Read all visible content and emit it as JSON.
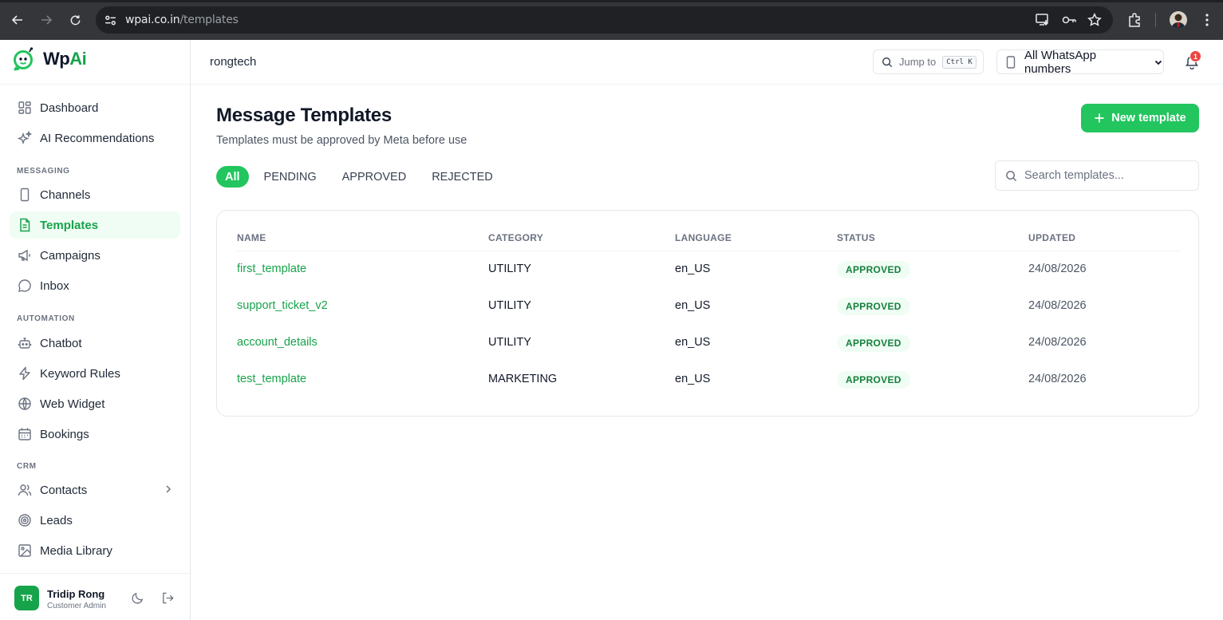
{
  "browser": {
    "url_host": "wpai.co.in",
    "url_path": "/templates"
  },
  "brand": {
    "name_part1": "Wp",
    "name_part2": "Ai",
    "accent": "#22c55e"
  },
  "sidebar": {
    "items_top": [
      {
        "label": "Dashboard",
        "icon": "grid-icon"
      },
      {
        "label": "AI Recommendations",
        "icon": "sparkles-icon"
      }
    ],
    "messaging_label": "MESSAGING",
    "messaging_items": [
      {
        "label": "Channels",
        "icon": "phone-icon"
      },
      {
        "label": "Templates",
        "icon": "file-text-icon",
        "active": true
      },
      {
        "label": "Campaigns",
        "icon": "megaphone-icon"
      },
      {
        "label": "Inbox",
        "icon": "chat-bubble-icon"
      }
    ],
    "automation_label": "AUTOMATION",
    "automation_items": [
      {
        "label": "Chatbot",
        "icon": "bot-icon"
      },
      {
        "label": "Keyword Rules",
        "icon": "zap-icon"
      },
      {
        "label": "Web Widget",
        "icon": "globe-icon"
      },
      {
        "label": "Bookings",
        "icon": "calendar-icon"
      }
    ],
    "crm_label": "CRM",
    "crm_items": [
      {
        "label": "Contacts",
        "icon": "users-icon"
      },
      {
        "label": "Leads",
        "icon": "target-icon"
      },
      {
        "label": "Media Library",
        "icon": "image-icon"
      }
    ],
    "user": {
      "initials": "TR",
      "name": "Tridip Rong",
      "role": "Customer Admin"
    }
  },
  "topbar": {
    "workspace": "rongtech",
    "jump_label": "Jump to",
    "jump_shortcut": "Ctrl K",
    "number_select": "All WhatsApp numbers",
    "notification_count": "1"
  },
  "page": {
    "title": "Message Templates",
    "subtitle": "Templates must be approved by Meta before use",
    "new_button": "New template",
    "tabs": [
      "All",
      "PENDING",
      "APPROVED",
      "REJECTED"
    ],
    "search_placeholder": "Search templates..."
  },
  "table": {
    "headers": [
      "NAME",
      "CATEGORY",
      "LANGUAGE",
      "STATUS",
      "UPDATED"
    ],
    "rows": [
      {
        "name": "first_template",
        "category": "UTILITY",
        "language": "en_US",
        "status": "APPROVED",
        "updated": "24/08/2026"
      },
      {
        "name": "support_ticket_v2",
        "category": "UTILITY",
        "language": "en_US",
        "status": "APPROVED",
        "updated": "24/08/2026"
      },
      {
        "name": "account_details",
        "category": "UTILITY",
        "language": "en_US",
        "status": "APPROVED",
        "updated": "24/08/2026"
      },
      {
        "name": "test_template",
        "category": "MARKETING",
        "language": "en_US",
        "status": "APPROVED",
        "updated": "24/08/2026"
      }
    ]
  }
}
